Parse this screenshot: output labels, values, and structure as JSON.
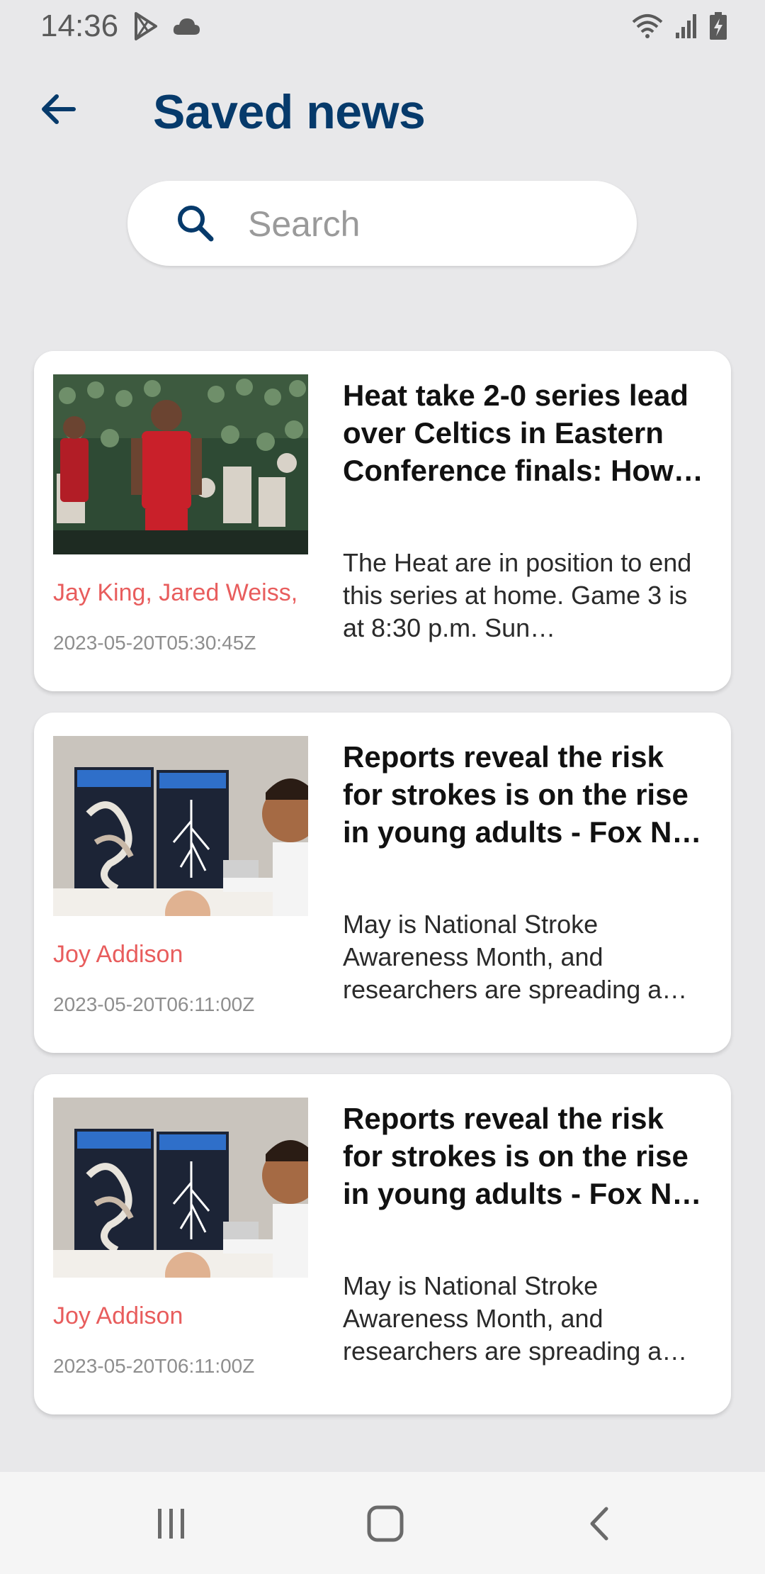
{
  "status_bar": {
    "time": "14:36",
    "left_icons": [
      "play-store-icon",
      "cloud-icon"
    ],
    "right_icons": [
      "wifi-icon",
      "signal-icon",
      "battery-charging-icon"
    ]
  },
  "header": {
    "title": "Saved news",
    "back_icon": "arrow-back-icon"
  },
  "search": {
    "placeholder": "Search",
    "value": ""
  },
  "articles": [
    {
      "headline": "Heat take 2-0 series lead over Celtics in Eastern Conference finals: How …",
      "summary": "The Heat are in position to end this series at home. Game 3 is at 8:30 p.m. Sun…",
      "author": "Jay King, Jared Weiss,",
      "date": "2023-05-20T05:30:45Z",
      "image": "basketball-players-photo"
    },
    {
      "headline": "Reports reveal the risk for strokes is on the rise in young adults - Fox N…",
      "summary": "May is National Stroke Awareness Month, and researchers are spreading a…",
      "author": "Joy Addison",
      "date": "2023-05-20T06:11:00Z",
      "image": "doctor-brain-scan-monitors-photo"
    },
    {
      "headline": "Reports reveal the risk for strokes is on the rise in young adults - Fox N…",
      "summary": "May is National Stroke Awareness Month, and researchers are spreading a…",
      "author": "Joy Addison",
      "date": "2023-05-20T06:11:00Z",
      "image": "doctor-brain-scan-monitors-photo"
    }
  ],
  "nav_bar": {
    "buttons": [
      "recents-icon",
      "home-icon",
      "back-icon"
    ]
  },
  "colors": {
    "background": "#e8e8ea",
    "title": "#063a6b",
    "author": "#e85d5d",
    "date": "#8e8e8e",
    "card": "#ffffff"
  }
}
